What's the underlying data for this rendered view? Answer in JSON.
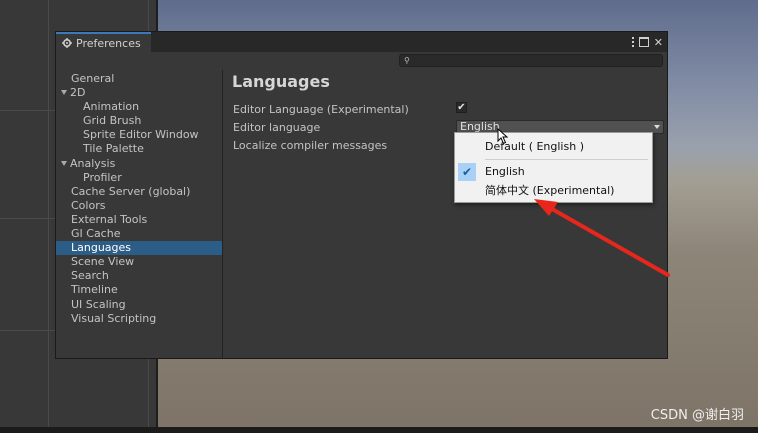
{
  "window": {
    "tab_title": "Preferences",
    "close_glyph": "✕"
  },
  "sidebar": {
    "items": [
      {
        "label": "General",
        "level": 0
      },
      {
        "label": "2D",
        "level": 0,
        "expanded": true
      },
      {
        "label": "Animation",
        "level": 1
      },
      {
        "label": "Grid Brush",
        "level": 1
      },
      {
        "label": "Sprite Editor Window",
        "level": 1
      },
      {
        "label": "Tile Palette",
        "level": 1
      },
      {
        "label": "Analysis",
        "level": 0,
        "expanded": true
      },
      {
        "label": "Profiler",
        "level": 1
      },
      {
        "label": "Cache Server (global)",
        "level": 0
      },
      {
        "label": "Colors",
        "level": 0
      },
      {
        "label": "External Tools",
        "level": 0
      },
      {
        "label": "GI Cache",
        "level": 0
      },
      {
        "label": "Languages",
        "level": 0,
        "selected": true
      },
      {
        "label": "Scene View",
        "level": 0
      },
      {
        "label": "Search",
        "level": 0
      },
      {
        "label": "Timeline",
        "level": 0
      },
      {
        "label": "UI Scaling",
        "level": 0
      },
      {
        "label": "Visual Scripting",
        "level": 0
      }
    ]
  },
  "main": {
    "title": "Languages",
    "editor_language_experimental_label": "Editor Language (Experimental)",
    "editor_language_experimental_checked": true,
    "editor_language_label": "Editor language",
    "editor_language_value": "English",
    "localize_compiler_label": "Localize compiler messages"
  },
  "language_menu": {
    "options": [
      {
        "label": "Default ( English )",
        "checked": false
      },
      {
        "label": "English",
        "checked": true
      },
      {
        "label": "简体中文 (Experimental)",
        "checked": false
      }
    ]
  },
  "watermark": "CSDN @谢白羽",
  "colors": {
    "selection": "#2c5d87",
    "tab_accent": "#3a79bb",
    "arrow": "#e8271c"
  }
}
